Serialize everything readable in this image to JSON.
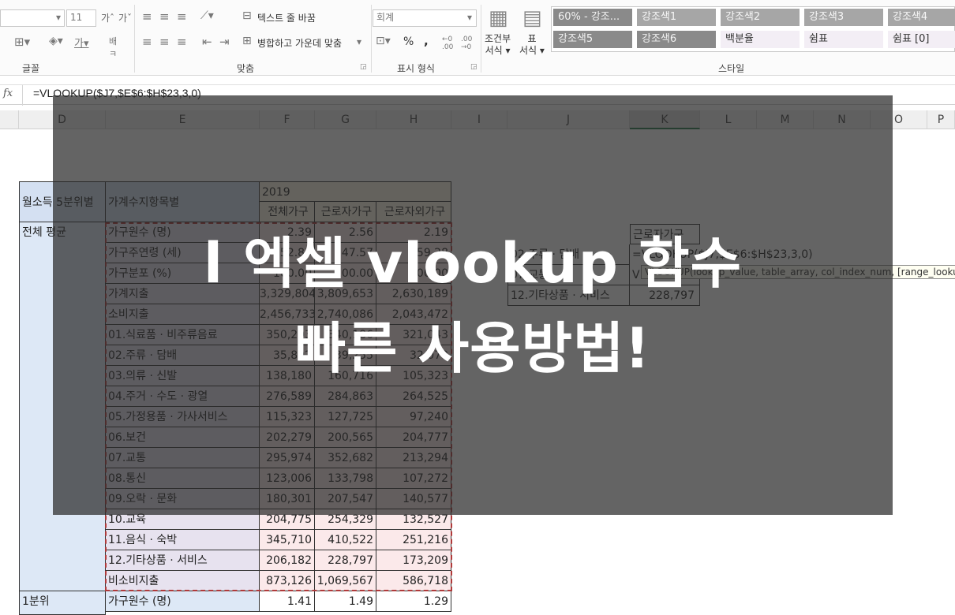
{
  "ribbon": {
    "font_size": "11",
    "font_label": "글꼴",
    "wrap_text": "텍스트 줄 바꿈",
    "merge_center": "병합하고 가운데 맞춤",
    "align_label": "맞춤",
    "number_format": "회계",
    "percent": "%",
    "comma": ",",
    "number_label": "표시 형식",
    "cond_format": "조건부\n서식",
    "cond_format_1": "조건부",
    "cond_format_2": "서식",
    "table_format_1": "표",
    "table_format_2": "서식",
    "styles_label": "스타일",
    "styles": [
      {
        "label": "60% - 강조...",
        "bg": "#8a8a8a",
        "fg": "#f2f2f2"
      },
      {
        "label": "강조색1",
        "bg": "#a6a6a6",
        "fg": "#f7f7f7"
      },
      {
        "label": "강조색2",
        "bg": "#a6a6a6",
        "fg": "#f7f7f7"
      },
      {
        "label": "강조색3",
        "bg": "#a6a6a6",
        "fg": "#f7f7f7"
      },
      {
        "label": "강조색4",
        "bg": "#a6a6a6",
        "fg": "#f7f7f7"
      },
      {
        "label": "강조색5",
        "bg": "#8a8a8a",
        "fg": "#f2f2f2"
      },
      {
        "label": "강조색6",
        "bg": "#8a8a8a",
        "fg": "#f2f2f2"
      },
      {
        "label": "백분율",
        "bg": "#f3eef5",
        "fg": "#333333"
      },
      {
        "label": "쉼표",
        "bg": "#f3eef5",
        "fg": "#333333"
      },
      {
        "label": "쉼표 [0]",
        "bg": "#f3eef5",
        "fg": "#333333"
      }
    ]
  },
  "formula_bar": {
    "fx": "fx",
    "formula": "=VLOOKUP($J7,$E$6:$H$23,3,0)"
  },
  "columns": [
    "D",
    "E",
    "F",
    "G",
    "H",
    "I",
    "J",
    "K",
    "L",
    "M",
    "N",
    "O",
    "P"
  ],
  "table": {
    "hdr_d": "월소득 5분위별",
    "hdr_e": "가계수지항목별",
    "year": "2019",
    "sub_headers": [
      "전체가구",
      "근로자가구",
      "근로자외가구"
    ],
    "group1": "전체 평균",
    "group2": "1분위",
    "rows": [
      {
        "label": "가구원수 (명)",
        "f": "2.39",
        "g": "2.56",
        "h": "2.19"
      },
      {
        "label": "가구주연령 (세)",
        "f": "52.85",
        "g": "47.57",
        "h": "59.28"
      },
      {
        "label": "가구분포 (%)",
        "f": "100.00",
        "g": "100.00",
        "h": "100.00"
      },
      {
        "label": "가계지출",
        "f": "3,329,804",
        "g": "3,809,653",
        "h": "2,630,189"
      },
      {
        "label": "소비지출",
        "f": "2,456,733",
        "g": "2,740,086",
        "h": "2,043,472"
      },
      {
        "label": "01.식료품 · 비주류음료",
        "f": "350,203",
        "g": "340,186",
        "h": "321,043"
      },
      {
        "label": "02.주류 · 담배",
        "f": "35,802",
        "g": "39,255",
        "h": "32,079"
      },
      {
        "label": "03.의류 · 신발",
        "f": "138,180",
        "g": "160,716",
        "h": "105,323"
      },
      {
        "label": "04.주거 · 수도 · 광열",
        "f": "276,589",
        "g": "284,863",
        "h": "264,525"
      },
      {
        "label": "05.가정용품 · 가사서비스",
        "f": "115,323",
        "g": "127,725",
        "h": "97,240"
      },
      {
        "label": "06.보건",
        "f": "202,279",
        "g": "200,565",
        "h": "204,777"
      },
      {
        "label": "07.교통",
        "f": "295,974",
        "g": "352,682",
        "h": "213,294"
      },
      {
        "label": "08.통신",
        "f": "123,006",
        "g": "133,798",
        "h": "107,272"
      },
      {
        "label": "09.오락 · 문화",
        "f": "180,301",
        "g": "207,547",
        "h": "140,577"
      },
      {
        "label": "10.교육",
        "f": "204,775",
        "g": "254,329",
        "h": "132,527"
      },
      {
        "label": "11.음식 · 숙박",
        "f": "345,710",
        "g": "410,522",
        "h": "251,216"
      },
      {
        "label": "12.기타상품 · 서비스",
        "f": "206,182",
        "g": "228,797",
        "h": "173,209"
      },
      {
        "label": "비소비지출",
        "f": "873,126",
        "g": "1,069,567",
        "h": "586,718"
      },
      {
        "label": "가구원수 (명)",
        "f": "1.41",
        "g": "1.49",
        "h": "1.29"
      }
    ]
  },
  "lookup": {
    "k_header": "근로자가구",
    "row1_j": "02.주류 · 담배",
    "row1_formula": "=VLOOKUP($J7,$E$6:$H$23,3,0)",
    "row2_j": "07.교통",
    "row2_k": "VLOOKUP",
    "tooltip": "VLOOKUP(lookup_value, table_array, col_index_num, [range_lookup])",
    "row3_j": "12.기타상품 · 서비스",
    "row3_k": "228,797"
  },
  "overlay": {
    "line1": "l  엑셀 vlookup 함수",
    "line2": "빠른 사용방법!"
  }
}
